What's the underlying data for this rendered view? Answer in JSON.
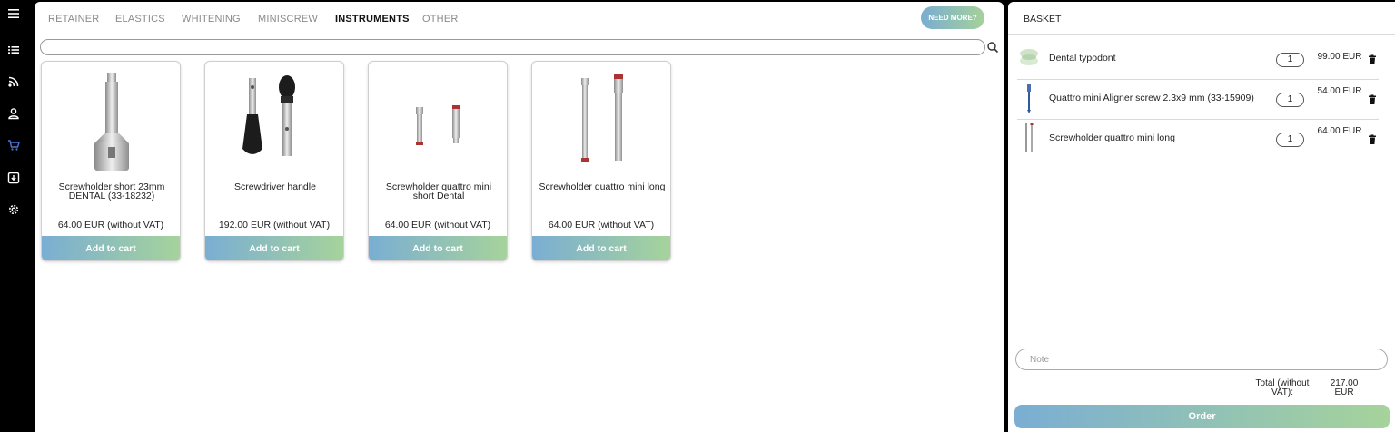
{
  "tabs": [
    {
      "label": "RETAINER"
    },
    {
      "label": "ELASTICS"
    },
    {
      "label": "WHITENING"
    },
    {
      "label": "MINISCREW"
    },
    {
      "label": "INSTRUMENTS",
      "active": true
    },
    {
      "label": "OTHER"
    }
  ],
  "need_more_label": "NEED MORE?",
  "search": {
    "placeholder": "",
    "value": ""
  },
  "products": [
    {
      "name": "Screwholder short 23mm DENTAL (33-18232)",
      "price": "64.00 EUR (without VAT)",
      "button": "Add to cart"
    },
    {
      "name": "Screwdriver handle",
      "price": "192.00 EUR (without VAT)",
      "button": "Add to cart"
    },
    {
      "name": "Screwholder quattro mini short Dental",
      "price": "64.00 EUR (without VAT)",
      "button": "Add to cart"
    },
    {
      "name": "Screwholder quattro mini long",
      "price": "64.00 EUR (without VAT)",
      "button": "Add to cart"
    }
  ],
  "basket": {
    "title": "BASKET",
    "items": [
      {
        "name": "Dental typodont",
        "qty": "1",
        "price": "99.00 EUR"
      },
      {
        "name": "Quattro mini Aligner screw 2.3x9 mm (33-15909)",
        "qty": "1",
        "price": "54.00 EUR"
      },
      {
        "name": "Screwholder quattro mini long",
        "qty": "1",
        "price": "64.00 EUR"
      }
    ],
    "note_placeholder": "Note",
    "total_label": "Total (without VAT):",
    "total_value": "217.00 EUR",
    "order_label": "Order"
  },
  "colors": {
    "gradient_start": "#7aaed3",
    "gradient_end": "#a6d39b",
    "sidebar_active": "#4a78d8"
  },
  "icons": [
    "menu-icon",
    "list-icon",
    "rss-icon",
    "user-icon",
    "cart-icon",
    "download-box-icon",
    "gear-icon",
    "search-icon",
    "trash-icon"
  ]
}
